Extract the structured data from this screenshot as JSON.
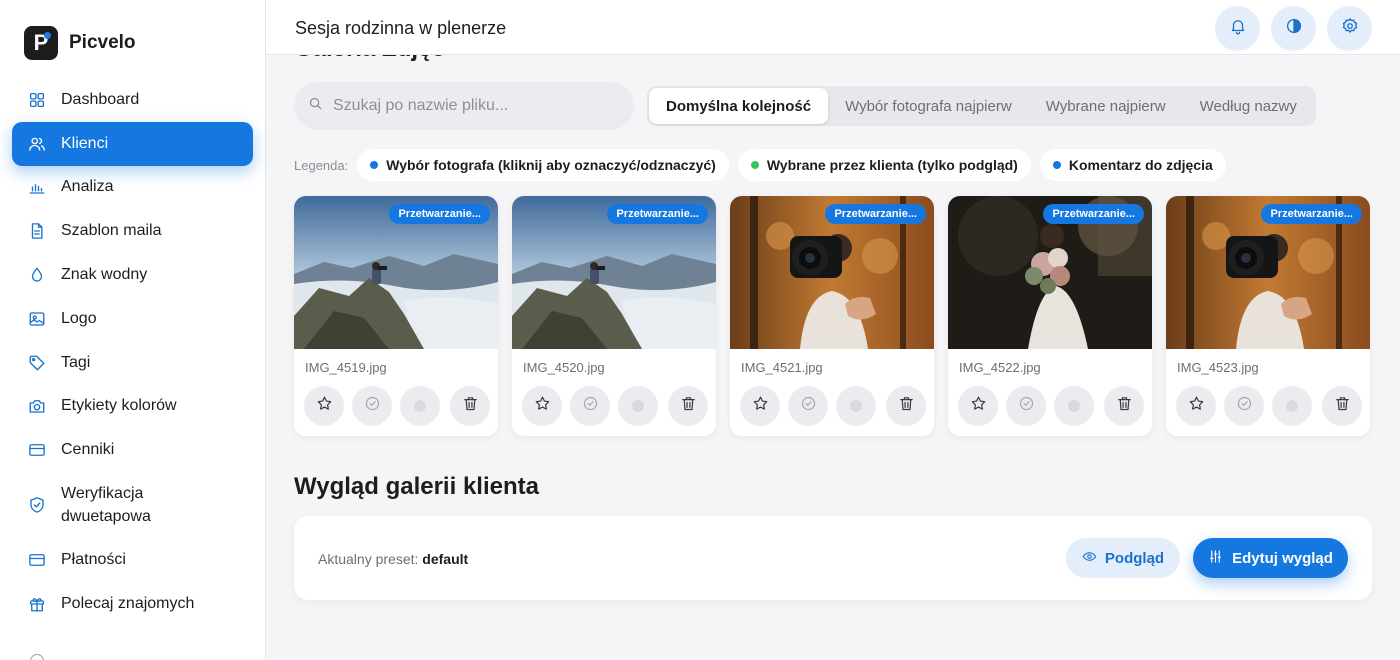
{
  "app": {
    "name": "Picvelo",
    "logo_letter": "P"
  },
  "sidebar": {
    "items": [
      {
        "label": "Dashboard",
        "icon": "grid-icon"
      },
      {
        "label": "Klienci",
        "icon": "users-icon",
        "active": true
      },
      {
        "label": "Analiza",
        "icon": "bar-chart-icon"
      },
      {
        "label": "Szablon maila",
        "icon": "document-icon"
      },
      {
        "label": "Znak wodny",
        "icon": "droplet-icon"
      },
      {
        "label": "Logo",
        "icon": "image-icon"
      },
      {
        "label": "Tagi",
        "icon": "tag-icon"
      },
      {
        "label": "Etykiety kolorów",
        "icon": "camera-icon"
      },
      {
        "label": "Cenniki",
        "icon": "credit-card-icon"
      },
      {
        "label": "Weryfikacja dwuetapowa",
        "icon": "shield-check-icon"
      },
      {
        "label": "Płatności",
        "icon": "credit-card-icon"
      },
      {
        "label": "Polecaj znajomych",
        "icon": "gift-icon"
      }
    ]
  },
  "header": {
    "title": "Sesja rodzinna w plenerze",
    "buttons": [
      "bell-icon",
      "contrast-icon",
      "settings-icon"
    ]
  },
  "gallery": {
    "title": "Galeria Zdjęć",
    "search_placeholder": "Szukaj po nazwie pliku...",
    "sort_options": [
      {
        "label": "Domyślna kolejność",
        "active": true
      },
      {
        "label": "Wybór fotografa najpierw"
      },
      {
        "label": "Wybrane najpierw"
      },
      {
        "label": "Według nazwy"
      }
    ],
    "legend": {
      "label": "Legenda:",
      "items": [
        {
          "label": "Wybór fotografa (kliknij aby oznaczyć/odznaczyć)",
          "color": "#1577e0"
        },
        {
          "label": "Wybrane przez klienta (tylko podgląd)",
          "color": "#34c759"
        },
        {
          "label": "Komentarz do zdjęcia",
          "color": "#1577e0"
        }
      ]
    },
    "photos": [
      {
        "filename": "IMG_4519.jpg",
        "status": "Przetwarzanie...",
        "scene": "mountain"
      },
      {
        "filename": "IMG_4520.jpg",
        "status": "Przetwarzanie...",
        "scene": "mountain"
      },
      {
        "filename": "IMG_4521.jpg",
        "status": "Przetwarzanie...",
        "scene": "camera"
      },
      {
        "filename": "IMG_4522.jpg",
        "status": "Przetwarzanie...",
        "scene": "bouquet"
      },
      {
        "filename": "IMG_4523.jpg",
        "status": "Przetwarzanie...",
        "scene": "camera"
      }
    ]
  },
  "appearance": {
    "title": "Wygląd galerii klienta",
    "preset_label": "Aktualny preset:",
    "preset_value": "default",
    "preview_label": "Podgląd",
    "edit_label": "Edytuj wygląd"
  },
  "colors": {
    "accent": "#1577e0",
    "accent_soft": "#e4eefa",
    "success": "#34c759"
  }
}
